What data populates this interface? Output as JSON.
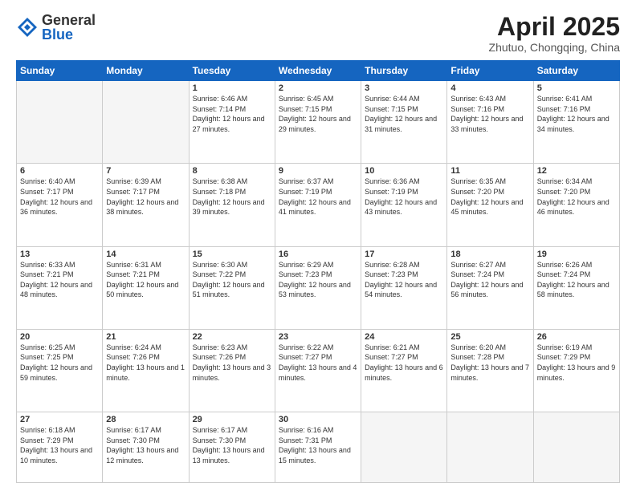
{
  "logo": {
    "general": "General",
    "blue": "Blue"
  },
  "title": "April 2025",
  "subtitle": "Zhutuo, Chongqing, China",
  "days": {
    "headers": [
      "Sunday",
      "Monday",
      "Tuesday",
      "Wednesday",
      "Thursday",
      "Friday",
      "Saturday"
    ]
  },
  "weeks": [
    [
      {
        "num": "",
        "info": "",
        "empty": true
      },
      {
        "num": "",
        "info": "",
        "empty": true
      },
      {
        "num": "1",
        "info": "Sunrise: 6:46 AM\nSunset: 7:14 PM\nDaylight: 12 hours and 27 minutes."
      },
      {
        "num": "2",
        "info": "Sunrise: 6:45 AM\nSunset: 7:15 PM\nDaylight: 12 hours and 29 minutes."
      },
      {
        "num": "3",
        "info": "Sunrise: 6:44 AM\nSunset: 7:15 PM\nDaylight: 12 hours and 31 minutes."
      },
      {
        "num": "4",
        "info": "Sunrise: 6:43 AM\nSunset: 7:16 PM\nDaylight: 12 hours and 33 minutes."
      },
      {
        "num": "5",
        "info": "Sunrise: 6:41 AM\nSunset: 7:16 PM\nDaylight: 12 hours and 34 minutes."
      }
    ],
    [
      {
        "num": "6",
        "info": "Sunrise: 6:40 AM\nSunset: 7:17 PM\nDaylight: 12 hours and 36 minutes."
      },
      {
        "num": "7",
        "info": "Sunrise: 6:39 AM\nSunset: 7:17 PM\nDaylight: 12 hours and 38 minutes."
      },
      {
        "num": "8",
        "info": "Sunrise: 6:38 AM\nSunset: 7:18 PM\nDaylight: 12 hours and 39 minutes."
      },
      {
        "num": "9",
        "info": "Sunrise: 6:37 AM\nSunset: 7:19 PM\nDaylight: 12 hours and 41 minutes."
      },
      {
        "num": "10",
        "info": "Sunrise: 6:36 AM\nSunset: 7:19 PM\nDaylight: 12 hours and 43 minutes."
      },
      {
        "num": "11",
        "info": "Sunrise: 6:35 AM\nSunset: 7:20 PM\nDaylight: 12 hours and 45 minutes."
      },
      {
        "num": "12",
        "info": "Sunrise: 6:34 AM\nSunset: 7:20 PM\nDaylight: 12 hours and 46 minutes."
      }
    ],
    [
      {
        "num": "13",
        "info": "Sunrise: 6:33 AM\nSunset: 7:21 PM\nDaylight: 12 hours and 48 minutes."
      },
      {
        "num": "14",
        "info": "Sunrise: 6:31 AM\nSunset: 7:21 PM\nDaylight: 12 hours and 50 minutes."
      },
      {
        "num": "15",
        "info": "Sunrise: 6:30 AM\nSunset: 7:22 PM\nDaylight: 12 hours and 51 minutes."
      },
      {
        "num": "16",
        "info": "Sunrise: 6:29 AM\nSunset: 7:23 PM\nDaylight: 12 hours and 53 minutes."
      },
      {
        "num": "17",
        "info": "Sunrise: 6:28 AM\nSunset: 7:23 PM\nDaylight: 12 hours and 54 minutes."
      },
      {
        "num": "18",
        "info": "Sunrise: 6:27 AM\nSunset: 7:24 PM\nDaylight: 12 hours and 56 minutes."
      },
      {
        "num": "19",
        "info": "Sunrise: 6:26 AM\nSunset: 7:24 PM\nDaylight: 12 hours and 58 minutes."
      }
    ],
    [
      {
        "num": "20",
        "info": "Sunrise: 6:25 AM\nSunset: 7:25 PM\nDaylight: 12 hours and 59 minutes."
      },
      {
        "num": "21",
        "info": "Sunrise: 6:24 AM\nSunset: 7:26 PM\nDaylight: 13 hours and 1 minute."
      },
      {
        "num": "22",
        "info": "Sunrise: 6:23 AM\nSunset: 7:26 PM\nDaylight: 13 hours and 3 minutes."
      },
      {
        "num": "23",
        "info": "Sunrise: 6:22 AM\nSunset: 7:27 PM\nDaylight: 13 hours and 4 minutes."
      },
      {
        "num": "24",
        "info": "Sunrise: 6:21 AM\nSunset: 7:27 PM\nDaylight: 13 hours and 6 minutes."
      },
      {
        "num": "25",
        "info": "Sunrise: 6:20 AM\nSunset: 7:28 PM\nDaylight: 13 hours and 7 minutes."
      },
      {
        "num": "26",
        "info": "Sunrise: 6:19 AM\nSunset: 7:29 PM\nDaylight: 13 hours and 9 minutes."
      }
    ],
    [
      {
        "num": "27",
        "info": "Sunrise: 6:18 AM\nSunset: 7:29 PM\nDaylight: 13 hours and 10 minutes."
      },
      {
        "num": "28",
        "info": "Sunrise: 6:17 AM\nSunset: 7:30 PM\nDaylight: 13 hours and 12 minutes."
      },
      {
        "num": "29",
        "info": "Sunrise: 6:17 AM\nSunset: 7:30 PM\nDaylight: 13 hours and 13 minutes."
      },
      {
        "num": "30",
        "info": "Sunrise: 6:16 AM\nSunset: 7:31 PM\nDaylight: 13 hours and 15 minutes."
      },
      {
        "num": "",
        "info": "",
        "empty": true
      },
      {
        "num": "",
        "info": "",
        "empty": true
      },
      {
        "num": "",
        "info": "",
        "empty": true
      }
    ]
  ]
}
